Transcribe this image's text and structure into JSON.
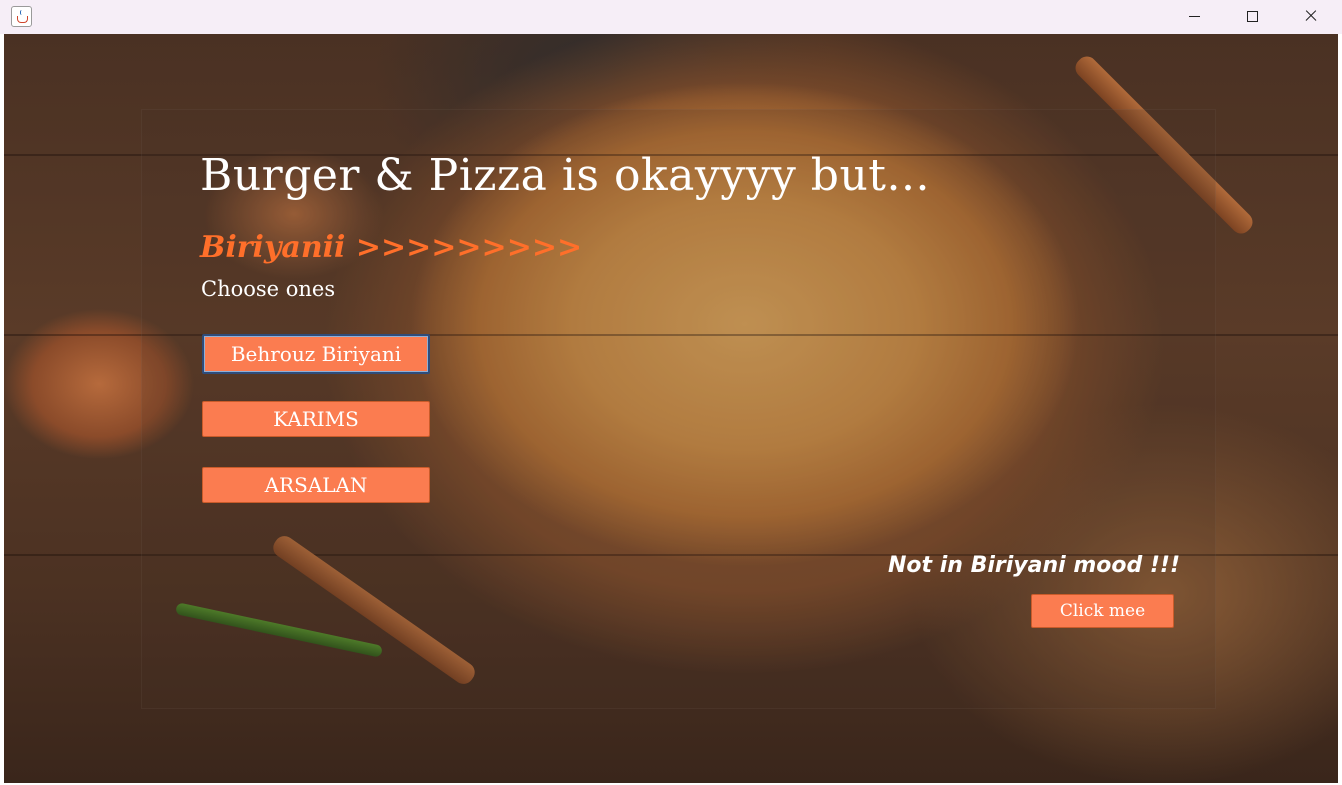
{
  "window": {
    "title": "",
    "icon": "java-cup-icon",
    "controls": [
      "minimize",
      "maximize",
      "close"
    ]
  },
  "background": {
    "subject": "biryani-bowl-photo"
  },
  "main": {
    "headline": "Burger & Pizza is okayyyy but...",
    "tagline": "Biriyanii >>>>>>>>>",
    "choose_label": "Choose ones",
    "options": [
      {
        "label": "Behrouz Biriyani"
      },
      {
        "label": "KARIMS"
      },
      {
        "label": "ARSALAN"
      }
    ],
    "mood_text": "Not in Biriyani mood !!!",
    "click_label": "Click mee"
  },
  "colors": {
    "accent_button": "#fb7c50",
    "tagline": "#ff6f2a",
    "text": "#ffffff"
  }
}
